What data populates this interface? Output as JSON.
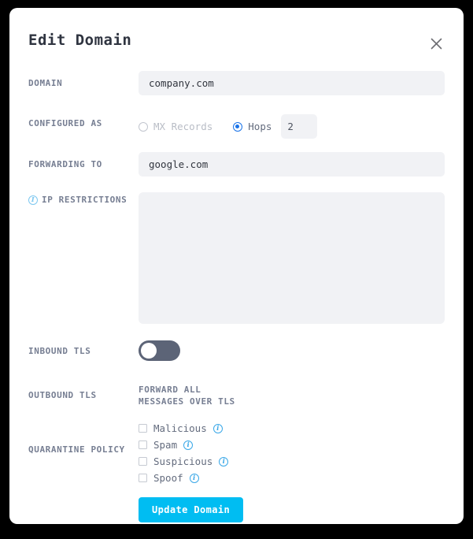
{
  "modal": {
    "title": "Edit Domain",
    "close_icon": "close-icon"
  },
  "fields": {
    "domain": {
      "label": "DOMAIN",
      "value": "company.com",
      "placeholder": ""
    },
    "configured_as": {
      "label": "CONFIGURED AS",
      "options": [
        {
          "label": "MX Records",
          "selected": false
        },
        {
          "label": "Hops",
          "selected": true
        }
      ],
      "hops_value": "2",
      "hops_placeholder": ""
    },
    "forwarding_to": {
      "label": "FORWARDING TO",
      "value": "google.com",
      "placeholder": ""
    },
    "ip_restrictions": {
      "label": "IP RESTRICTIONS",
      "info_icon": "info-icon",
      "value": "",
      "placeholder": ""
    },
    "inbound_tls": {
      "label": "INBOUND TLS",
      "enabled": false
    },
    "outbound_tls": {
      "label": "OUTBOUND TLS",
      "text_line1": "FORWARD ALL",
      "text_line2": "MESSAGES OVER TLS"
    },
    "quarantine_policy": {
      "label": "QUARANTINE POLICY",
      "items": [
        {
          "label": "Malicious",
          "checked": false,
          "info_icon": "info-icon"
        },
        {
          "label": "Spam",
          "checked": false,
          "info_icon": "info-icon"
        },
        {
          "label": "Suspicious",
          "checked": false,
          "info_icon": "info-icon"
        },
        {
          "label": "Spoof",
          "checked": false,
          "info_icon": "info-icon"
        }
      ]
    }
  },
  "actions": {
    "submit_label": "Update Domain"
  },
  "colors": {
    "accent": "#00bdf2",
    "radio_selected": "#1a73e8",
    "label": "#767e92",
    "input_bg": "#f1f2f5",
    "toggle_off": "#5c6477",
    "info": "#7ec8f0"
  }
}
